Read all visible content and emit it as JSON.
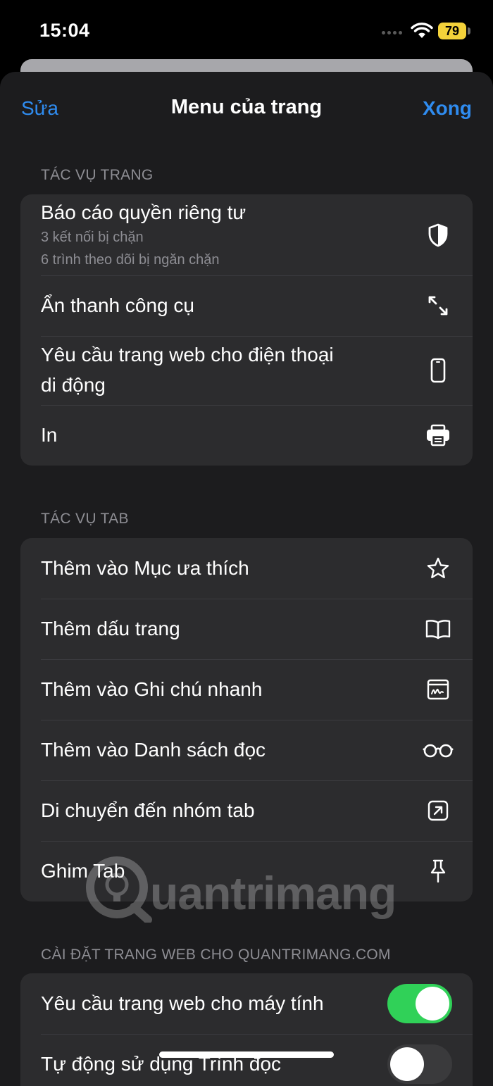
{
  "status_bar": {
    "time": "15:04",
    "battery": "79"
  },
  "nav": {
    "left": "Sửa",
    "title": "Menu của trang",
    "right": "Xong"
  },
  "page_actions": {
    "header": "TÁC VỤ TRANG",
    "privacy": {
      "label": "Báo cáo quyền riêng tư",
      "sub1": "3 kết nối bị chặn",
      "sub2": "6 trình theo dõi bị ngăn chặn",
      "icon": "shield-icon"
    },
    "hide_toolbar": {
      "label": "Ẩn thanh công cụ",
      "icon": "resize-arrows-icon"
    },
    "mobile_site": {
      "label_line1": "Yêu cầu trang web cho điện thoại",
      "label_line2": "di động",
      "icon": "phone-icon"
    },
    "print": {
      "label": "In",
      "icon": "printer-icon"
    }
  },
  "tab_actions": {
    "header": "TÁC VỤ TAB",
    "items": [
      {
        "label": "Thêm vào Mục ưa thích",
        "icon": "star-icon"
      },
      {
        "label": "Thêm dấu trang",
        "icon": "book-icon"
      },
      {
        "label": "Thêm vào Ghi chú nhanh",
        "icon": "quick-note-icon"
      },
      {
        "label": "Thêm vào Danh sách đọc",
        "icon": "glasses-icon"
      },
      {
        "label": "Di chuyển đến nhóm tab",
        "icon": "move-arrow-icon"
      },
      {
        "label": "Ghim Tab",
        "icon": "pin-icon"
      }
    ]
  },
  "site_settings": {
    "header": "CÀI ĐẶT TRANG WEB CHO QUANTRIMANG.COM",
    "desktop_site": {
      "label": "Yêu cầu trang web cho máy tính",
      "on": true
    },
    "reader": {
      "label": "Tự động sử dụng Trình đọc",
      "on": false
    }
  },
  "watermark": {
    "text": "uantrimang"
  },
  "colors": {
    "accent": "#2f8cf0",
    "toggle_on": "#30d158",
    "toggle_off": "#3a3a3c",
    "battery": "#f4d23a"
  }
}
